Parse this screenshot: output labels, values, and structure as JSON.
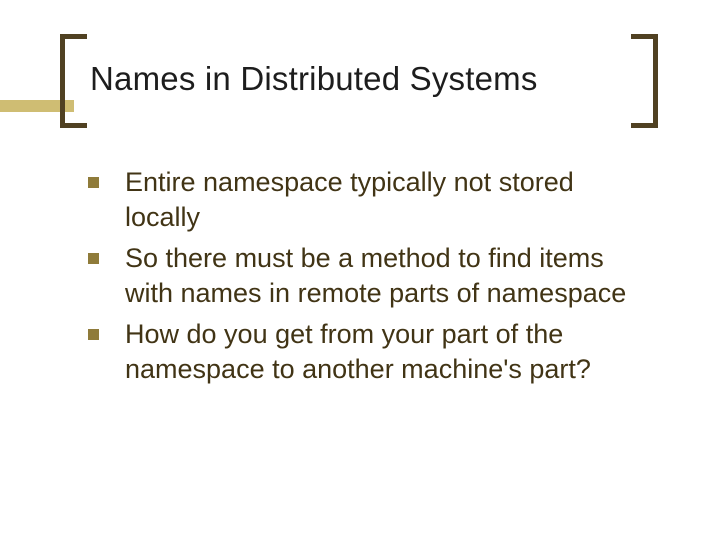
{
  "title": "Names in Distributed Systems",
  "bullets": {
    "b1": "Entire namespace typically not stored locally",
    "b2": "So there must be a method to find items with names in remote parts of namespace",
    "b3": "How do you get from your part of the namespace to another machine's part?"
  }
}
